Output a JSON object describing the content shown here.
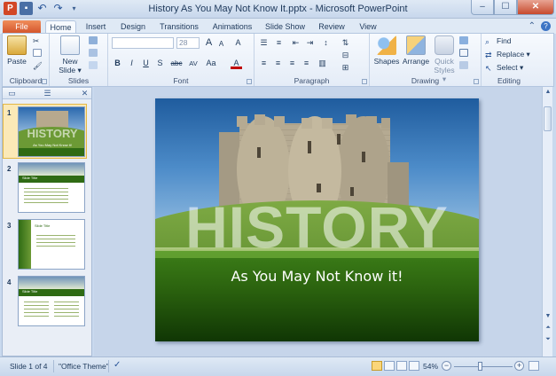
{
  "window": {
    "title": "History As You May Not Know It.pptx - Microsoft PowerPoint",
    "app_icon": "P",
    "minimize": "–",
    "maximize": "☐",
    "close": "✕"
  },
  "tabs": [
    "File",
    "Home",
    "Insert",
    "Design",
    "Transitions",
    "Animations",
    "Slide Show",
    "Review",
    "View"
  ],
  "active_tab": "Home",
  "ribbon": {
    "clipboard": {
      "label": "Clipboard",
      "paste": "Paste"
    },
    "slides": {
      "label": "Slides",
      "new_slide": "New",
      "new_slide2": "Slide ▾"
    },
    "font": {
      "label": "Font",
      "size_value": "28",
      "bold": "B",
      "italic": "I",
      "underline": "U",
      "shadow": "S",
      "strike": "abc",
      "spacing": "AV",
      "case": "Aa",
      "color": "A",
      "grow": "A",
      "shrink": "A",
      "clear": "A"
    },
    "paragraph": {
      "label": "Paragraph"
    },
    "drawing": {
      "label": "Drawing",
      "shapes": "Shapes",
      "arrange": "Arrange",
      "quick_styles": "Quick",
      "quick_styles2": "Styles ▾"
    },
    "editing": {
      "label": "Editing",
      "find": "Find",
      "replace": "Replace ▾",
      "select": "Select ▾"
    }
  },
  "thumbnails": {
    "items": [
      {
        "num": "1",
        "title": "HISTORY"
      },
      {
        "num": "2",
        "title": "Slide Title"
      },
      {
        "num": "3",
        "title": "Slide Title"
      },
      {
        "num": "4",
        "title": "Slide Title"
      }
    ]
  },
  "slide": {
    "title": "HISTORY",
    "subtitle": "As You May Not Know it!"
  },
  "status": {
    "slide_info": "Slide 1 of 4",
    "theme": "\"Office Theme\"",
    "zoom": "54%"
  },
  "colors": {
    "file_tab": "#d2522a",
    "ribbon_bg": "#e4ecf7",
    "slide_band": "#2c640f",
    "sky": "#4d8cc9"
  }
}
